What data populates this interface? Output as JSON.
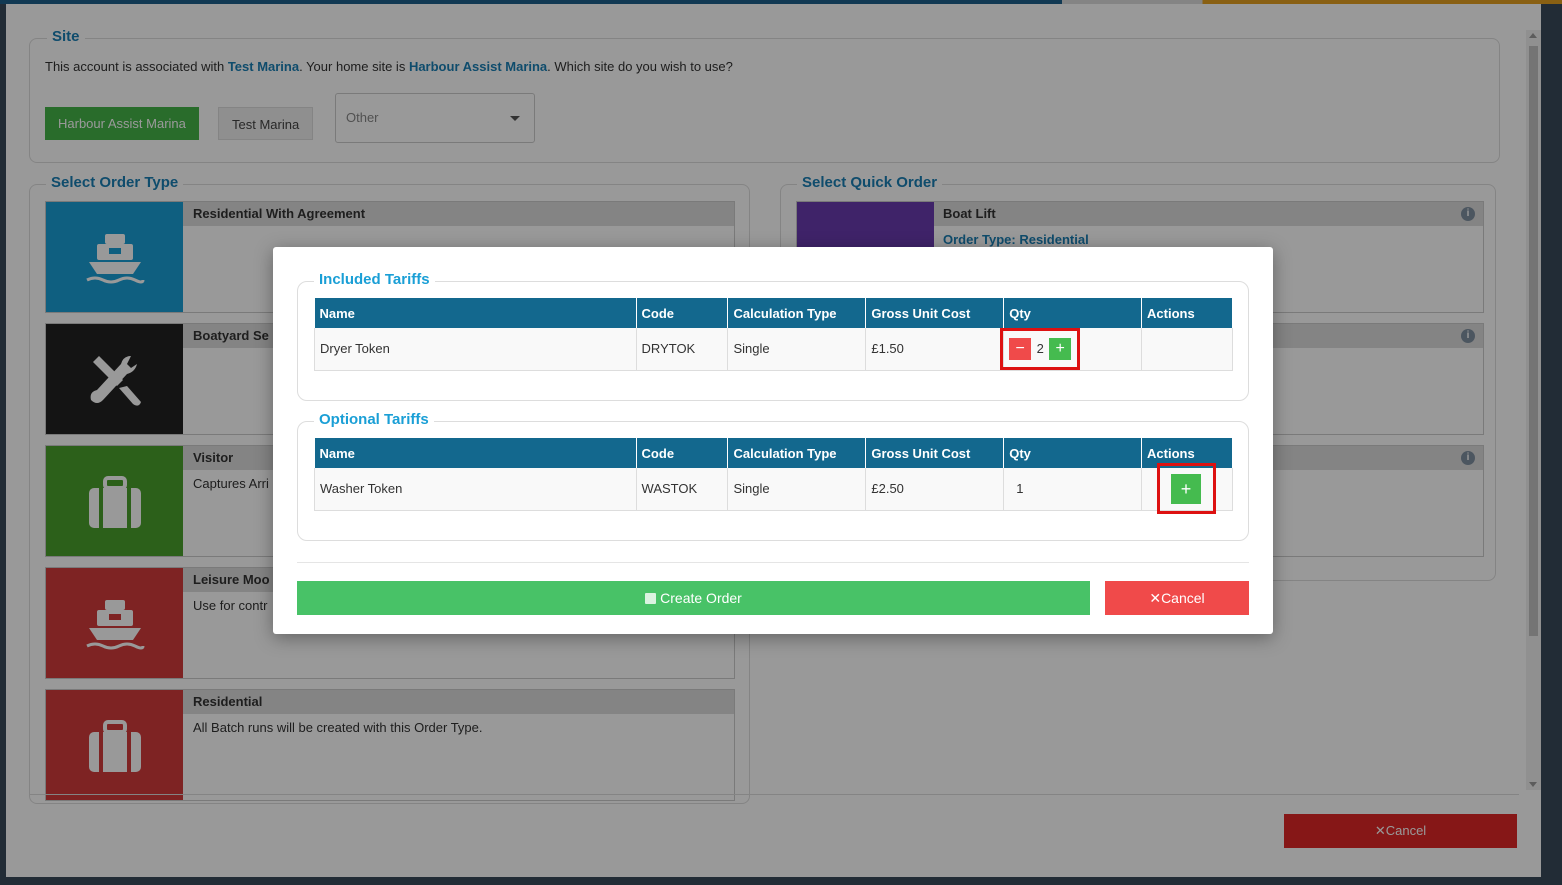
{
  "site": {
    "legend": "Site",
    "text_prefix": "This account is associated with ",
    "assoc_site": "Test Marina",
    "text_mid": ". Your home site is ",
    "home_site": "Harbour Assist Marina",
    "text_suffix": ". Which site do you wish to use?",
    "btn_harbour": "Harbour Assist Marina",
    "btn_test": "Test Marina",
    "select_value": "Other"
  },
  "order_type": {
    "legend": "Select Order Type",
    "cards": [
      {
        "title": "Residential With Agreement",
        "desc": "",
        "color": "#1a9fd6",
        "icon": "boat-icon"
      },
      {
        "title": "Boatyard Se",
        "desc": "",
        "color": "#222222",
        "icon": "tools-icon"
      },
      {
        "title": "Visitor",
        "desc": "Captures Arri",
        "color": "#4aa02c",
        "icon": "suitcase-icon"
      },
      {
        "title": "Leisure Moo",
        "desc": "Use for contr",
        "color": "#d23b3b",
        "icon": "boat-icon"
      },
      {
        "title": "Residential",
        "desc": "All Batch runs will be created with this Order Type.",
        "color": "#d23b3b",
        "icon": "suitcase-icon"
      }
    ]
  },
  "quick_order": {
    "legend": "Select Quick Order",
    "cards": [
      {
        "title": "Boat Lift",
        "sub": "Order Type: Residential",
        "color": "#6a3bb0"
      }
    ]
  },
  "footer": {
    "cancel": "Cancel"
  },
  "modal": {
    "included": {
      "legend": "Included Tariffs",
      "columns": [
        "Name",
        "Code",
        "Calculation Type",
        "Gross Unit Cost",
        "Qty",
        "Actions"
      ],
      "rows": [
        {
          "name": "Dryer Token",
          "code": "DRYTOK",
          "calc": "Single",
          "cost": "£1.50",
          "qty": "2"
        }
      ]
    },
    "optional": {
      "legend": "Optional Tariffs",
      "columns": [
        "Name",
        "Code",
        "Calculation Type",
        "Gross Unit Cost",
        "Qty",
        "Actions"
      ],
      "rows": [
        {
          "name": "Washer Token",
          "code": "WASTOK",
          "calc": "Single",
          "cost": "£2.50",
          "qty": "1"
        }
      ]
    },
    "create_label": "Create Order",
    "cancel_label": "Cancel"
  }
}
